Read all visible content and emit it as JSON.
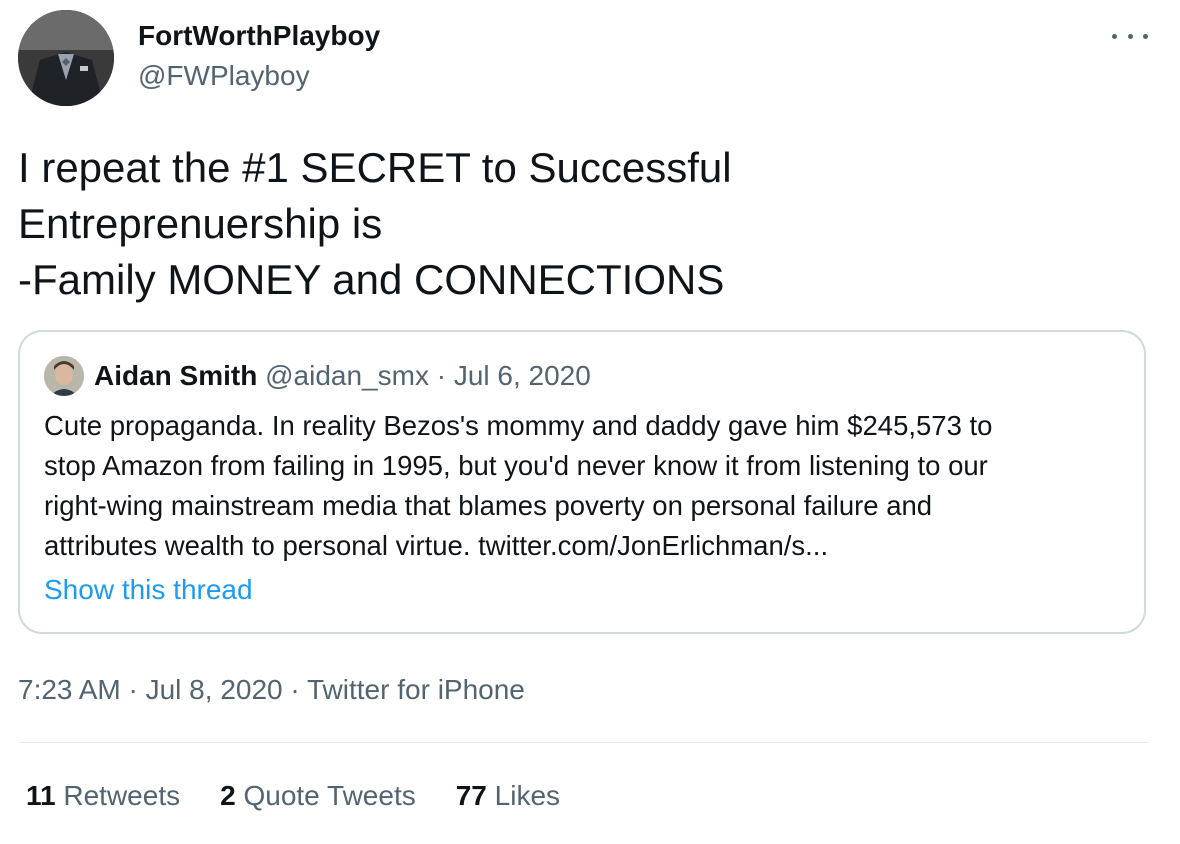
{
  "author": {
    "name": "FortWorthPlayboy",
    "handle": "@FWPlayboy"
  },
  "tweet": {
    "lines": [
      "I repeat the #1 SECRET to Successful",
      "Entreprenuership is",
      "-Family MONEY and CONNECTIONS"
    ]
  },
  "quoted": {
    "name": "Aidan Smith",
    "meta": "@aidan_smx · Jul 6, 2020",
    "lines": [
      "Cute propaganda. In reality Bezos's mommy and daddy gave him $245,573 to",
      "stop Amazon from failing in 1995, but you'd never know it from listening to our",
      "right-wing mainstream media that blames poverty on personal failure and",
      "attributes wealth to personal virtue. twitter.com/JonErlichman/s..."
    ],
    "show_thread": "Show this thread"
  },
  "timestamp": {
    "time": "7:23 AM · Jul 8, 2020",
    "separator": " · ",
    "source": "Twitter for iPhone"
  },
  "stats": {
    "retweets": {
      "count": "11",
      "label": "Retweets"
    },
    "quotes": {
      "count": "2",
      "label": "Quote Tweets"
    },
    "likes": {
      "count": "77",
      "label": "Likes"
    }
  },
  "colors": {
    "link": "#1d9bf0",
    "secondary_text": "#536471",
    "border": "#cfd9de"
  },
  "icons": {
    "more": "more-horizontal-icon"
  }
}
